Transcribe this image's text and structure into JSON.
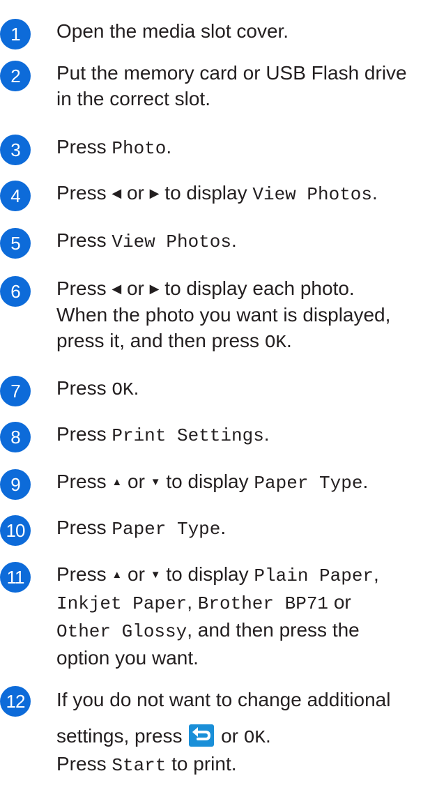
{
  "badge_color": "#0d6bd9",
  "steps": [
    {
      "num": "1",
      "text": "Open the media slot cover."
    },
    {
      "num": "2",
      "line1": "Put the memory card or USB Flash drive",
      "line2": "in the correct slot."
    },
    {
      "num": "3",
      "a": "Press",
      "b": "Photo"
    },
    {
      "num": "4",
      "a": "Press",
      "left_arrow": "◀",
      "or": "or",
      "right_arrow": "▶",
      "c": "to display",
      "d": "View Photos"
    },
    {
      "num": "5",
      "a": "Press",
      "b": "View Photos"
    },
    {
      "num": "6",
      "a": "Press",
      "left_arrow": "◀",
      "or": "or",
      "right_arrow": "▶",
      "c": "to display each photo.",
      "line2": "When the photo you want is displayed,",
      "line3a": "press it, and then press",
      "line3b": "OK"
    },
    {
      "num": "7",
      "a": "Press",
      "b": "OK"
    },
    {
      "num": "8",
      "a": "Press",
      "b": "Print Settings"
    },
    {
      "num": "9",
      "a": "Press",
      "up_arrow": "▲",
      "or": "or",
      "down_arrow": "▼",
      "c": "to display",
      "d": "Paper Type"
    },
    {
      "num": "10",
      "a": "Press",
      "b": "Paper Type"
    },
    {
      "num": "11",
      "a": "Press",
      "up_arrow": "▲",
      "or": "or",
      "down_arrow": "▼",
      "c": "to display",
      "d": "Plain Paper",
      "opt2": "Inkjet Paper",
      "opt3": "Brother BP71",
      "or2": "or",
      "opt4": "Other Glossy",
      "tail1": ", and then press the",
      "tail2": "option you want."
    },
    {
      "num": "12",
      "line1": "If you do not want to change additional",
      "a": "settings, press",
      "back_icon": "back-arrow-icon",
      "or": "or",
      "ok": "OK",
      "line3a": "Press",
      "line3b": "Start",
      "line3c": "to print."
    }
  ]
}
